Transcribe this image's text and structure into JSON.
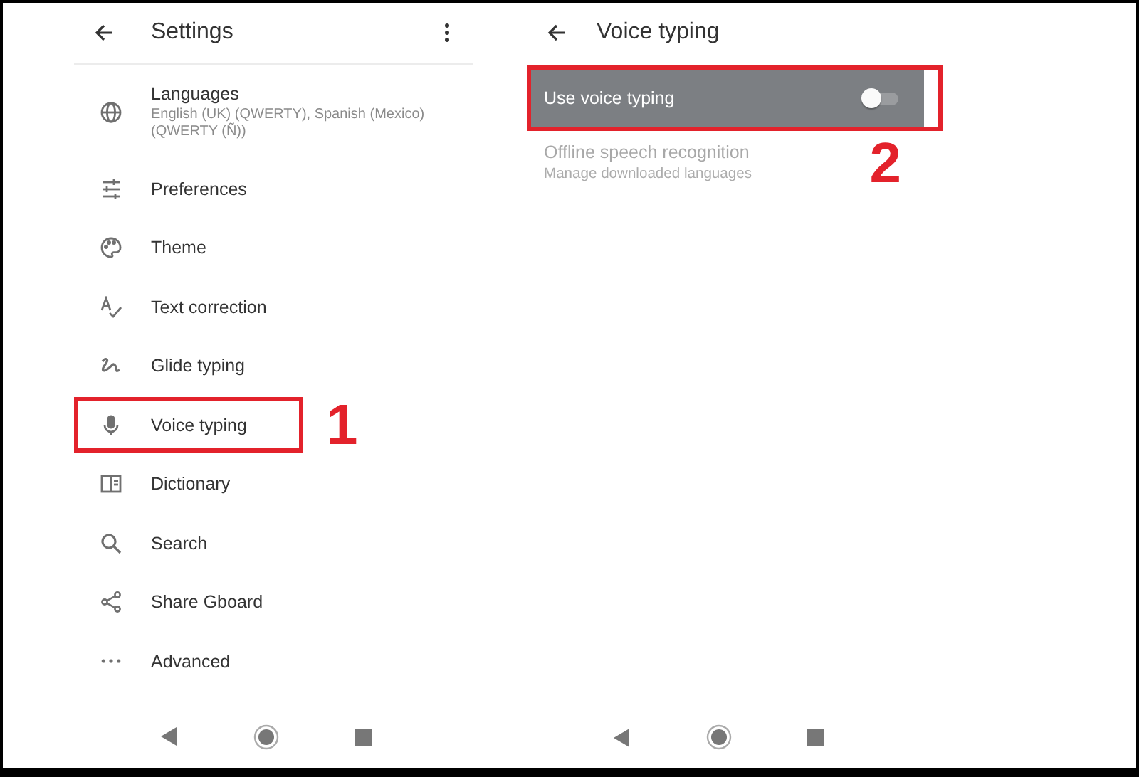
{
  "settings": {
    "title": "Settings",
    "items": [
      {
        "label": "Languages",
        "subtitle": "English (UK) (QWERTY), Spanish (Mexico) (QWERTY (Ñ))",
        "highlighted": false
      },
      {
        "label": "Preferences",
        "highlighted": false
      },
      {
        "label": "Theme",
        "highlighted": false
      },
      {
        "label": "Text correction",
        "highlighted": false
      },
      {
        "label": "Glide typing",
        "highlighted": false
      },
      {
        "label": "Voice typing",
        "highlighted": true,
        "callout": "1"
      },
      {
        "label": "Dictionary",
        "highlighted": false
      },
      {
        "label": "Search",
        "highlighted": false
      },
      {
        "label": "Share Gboard",
        "highlighted": false
      },
      {
        "label": "Advanced",
        "highlighted": false
      }
    ]
  },
  "voice_typing": {
    "title": "Voice typing",
    "options": [
      {
        "kind": "toggle",
        "label": "Use voice typing",
        "on": false,
        "highlighted": true,
        "callout": "2"
      },
      {
        "kind": "text",
        "label": "Offline speech recognition",
        "subtitle": "Manage downloaded languages",
        "disabled": true
      }
    ]
  }
}
